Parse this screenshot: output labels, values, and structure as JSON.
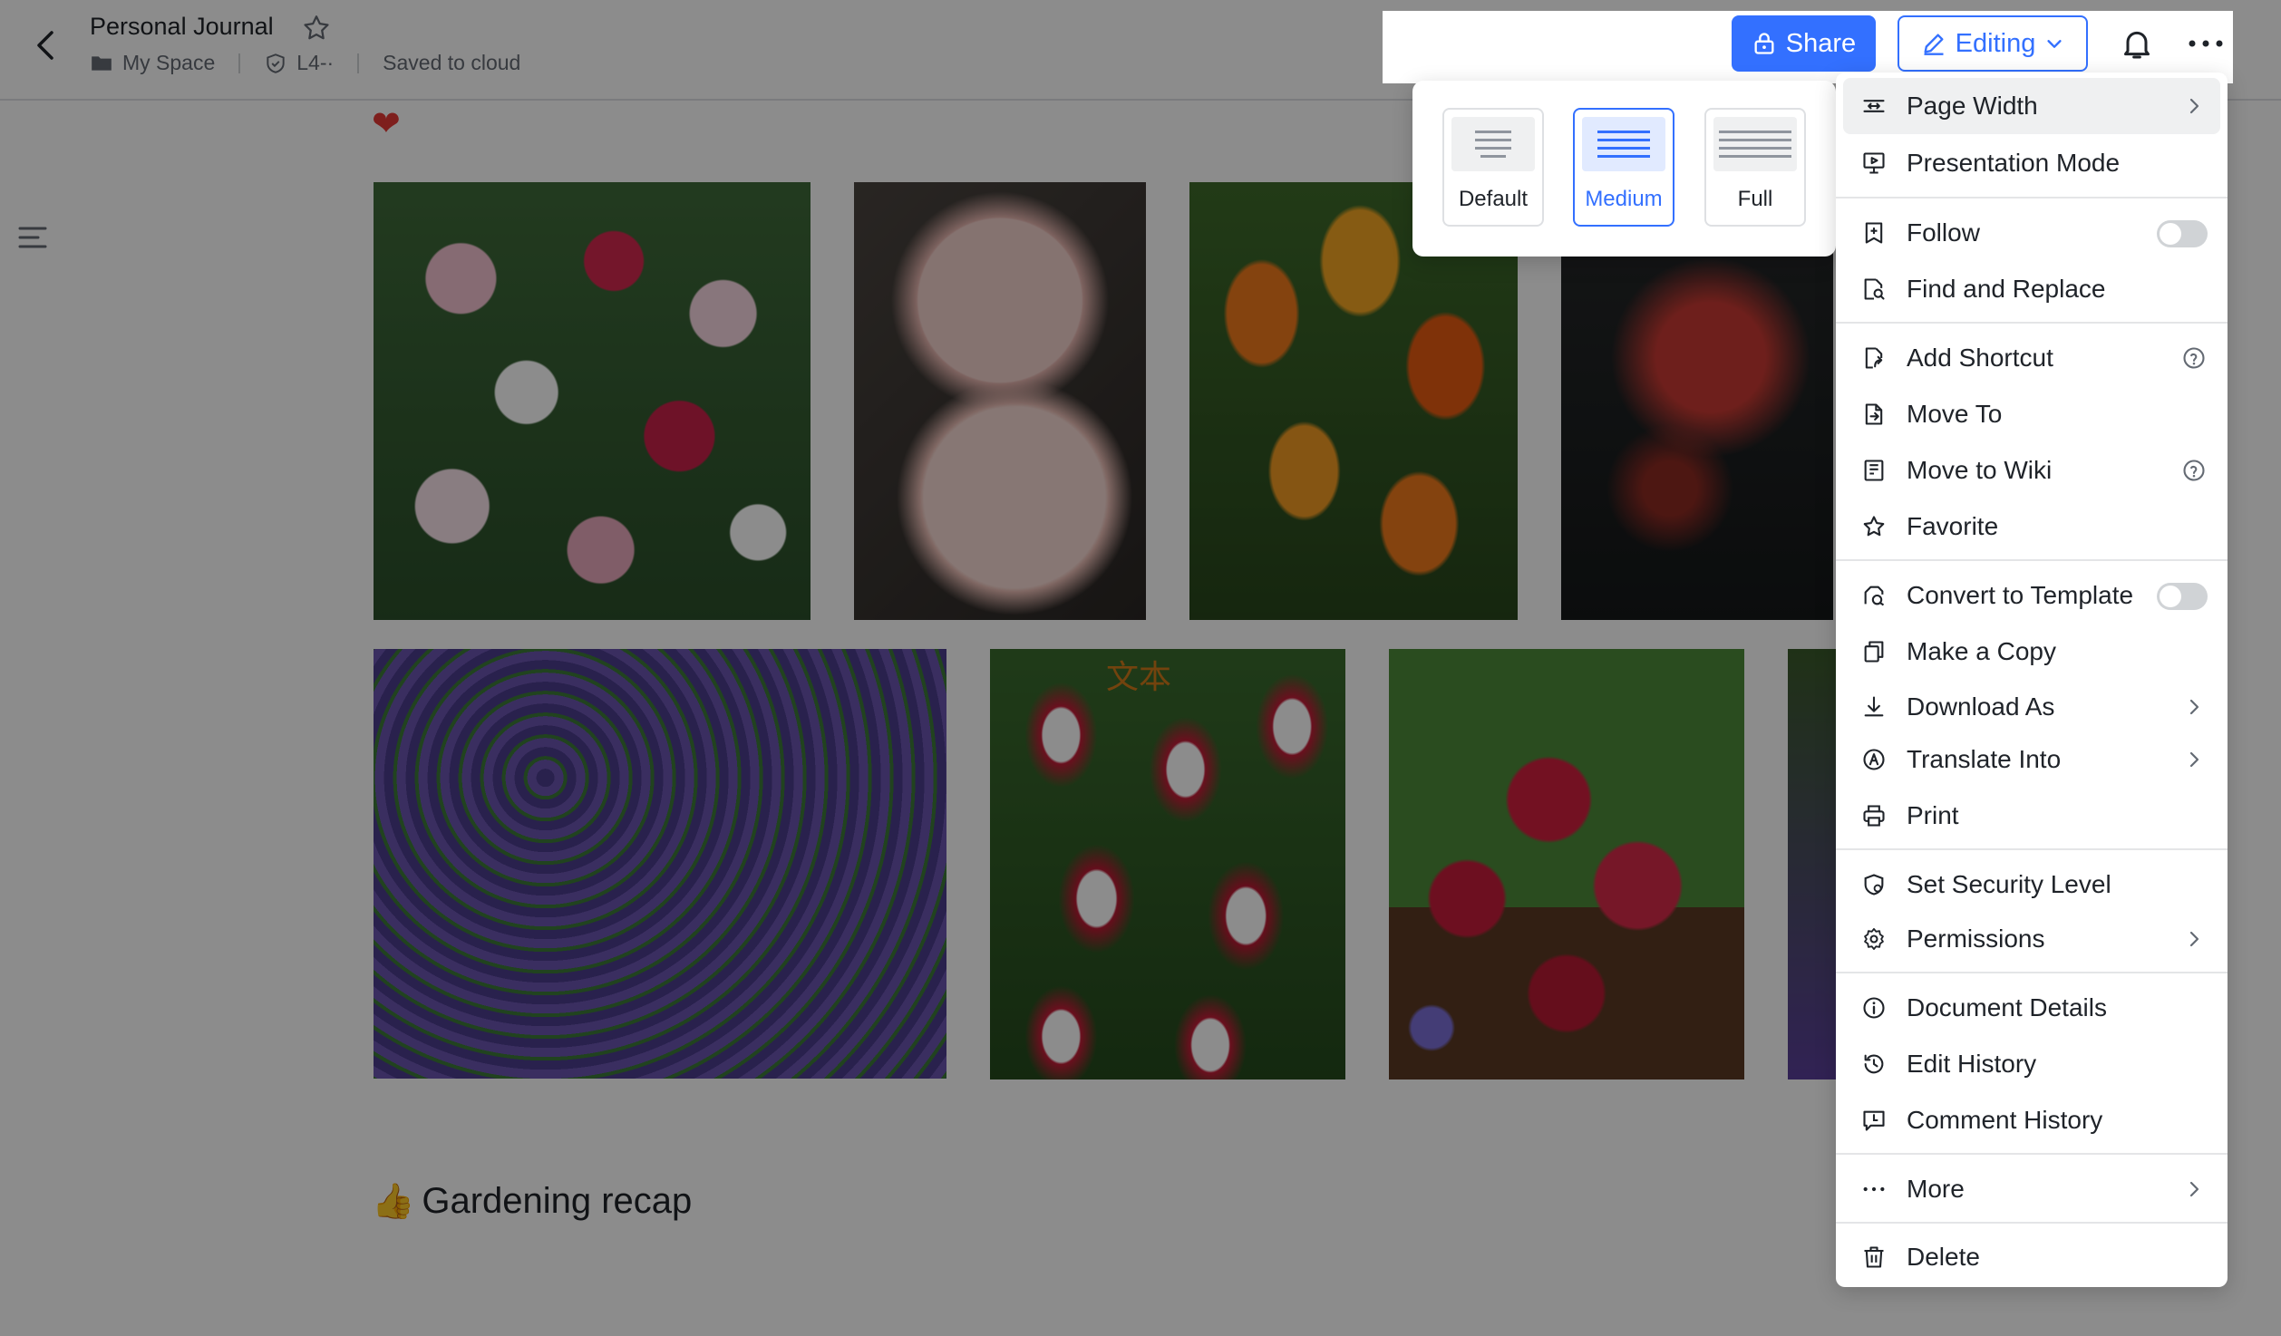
{
  "header": {
    "title": "Personal Journal",
    "location": "My Space",
    "security_label": "L4-·",
    "save_status": "Saved to cloud",
    "share_label": "Share",
    "mode_label": "Editing"
  },
  "content": {
    "heart": "❤",
    "image_caption_overlay": "文本",
    "section_emoji": "👍",
    "section_heading": "Gardening recap"
  },
  "page_width_menu": {
    "options": [
      {
        "label": "Default",
        "selected": false
      },
      {
        "label": "Medium",
        "selected": true
      },
      {
        "label": "Full",
        "selected": false
      }
    ]
  },
  "more_menu": {
    "items": [
      {
        "label": "Page Width",
        "icon": "page-width-icon",
        "right": "chevron"
      },
      {
        "label": "Presentation Mode",
        "icon": "presentation-icon"
      },
      {
        "label": "Follow",
        "icon": "follow-icon",
        "right": "toggle",
        "value": false
      },
      {
        "label": "Find and Replace",
        "icon": "find-replace-icon"
      },
      {
        "label": "Add Shortcut",
        "icon": "shortcut-icon",
        "right": "help"
      },
      {
        "label": "Move To",
        "icon": "move-icon"
      },
      {
        "label": "Move to Wiki",
        "icon": "wiki-icon",
        "right": "help"
      },
      {
        "label": "Favorite",
        "icon": "star-icon"
      },
      {
        "label": "Convert to Template",
        "icon": "template-icon",
        "right": "toggle",
        "value": false
      },
      {
        "label": "Make a Copy",
        "icon": "copy-icon"
      },
      {
        "label": "Download As",
        "icon": "download-icon",
        "right": "chevron"
      },
      {
        "label": "Translate Into",
        "icon": "translate-icon",
        "right": "chevron"
      },
      {
        "label": "Print",
        "icon": "print-icon"
      },
      {
        "label": "Set Security Level",
        "icon": "security-icon"
      },
      {
        "label": "Permissions",
        "icon": "permissions-icon",
        "right": "chevron"
      },
      {
        "label": "Document Details",
        "icon": "info-icon"
      },
      {
        "label": "Edit History",
        "icon": "history-icon"
      },
      {
        "label": "Comment History",
        "icon": "comment-icon"
      },
      {
        "label": "More",
        "icon": "more-icon",
        "right": "chevron"
      },
      {
        "label": "Delete",
        "icon": "trash-icon"
      }
    ]
  },
  "colors": {
    "accent": "#3370ff",
    "text": "#1f2329",
    "muted": "#646a73"
  }
}
